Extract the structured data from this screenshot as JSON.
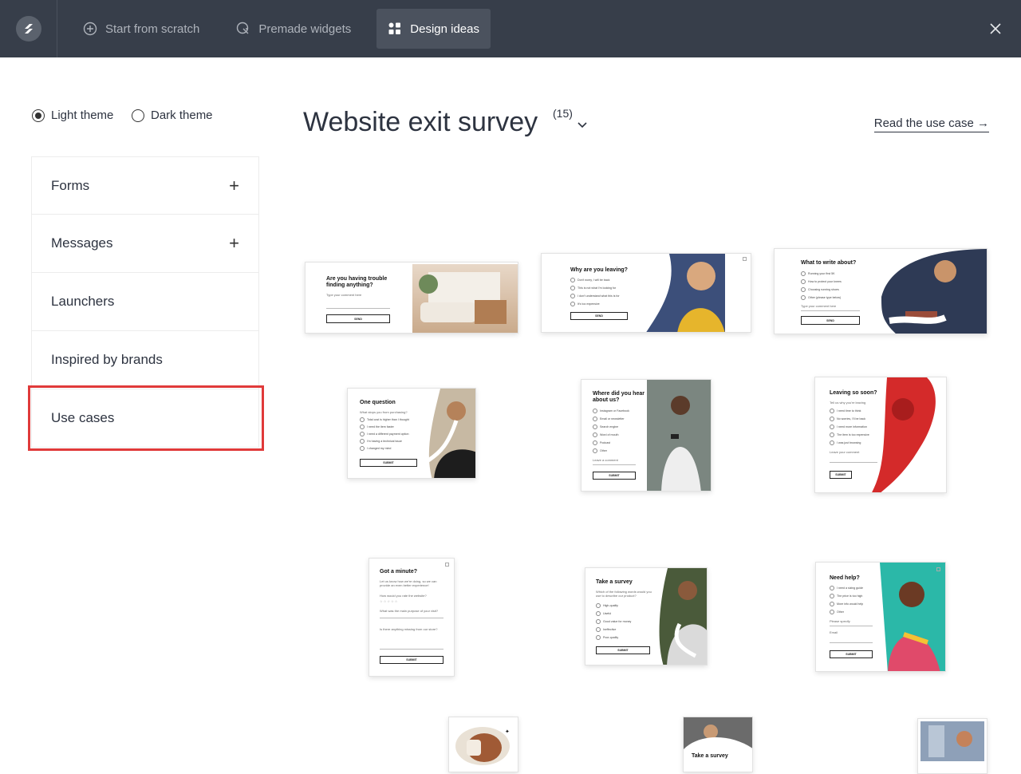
{
  "topbar": {
    "tabs": [
      {
        "label": "Start from scratch",
        "icon": "plus-circle-icon"
      },
      {
        "label": "Premade widgets",
        "icon": "widget-icon"
      },
      {
        "label": "Design ideas",
        "icon": "grid-icon"
      }
    ]
  },
  "theme": {
    "light": "Light theme",
    "dark": "Dark theme"
  },
  "sidebar": {
    "items": [
      {
        "label": "Forms"
      },
      {
        "label": "Messages"
      },
      {
        "label": "Launchers"
      },
      {
        "label": "Inspired by brands"
      },
      {
        "label": "Use cases"
      }
    ]
  },
  "main": {
    "title": "Website exit survey",
    "count": "(15)",
    "read_link": "Read the use case →"
  },
  "cards": [
    {
      "title": "Are you having trouble finding anything?",
      "sub": "Type your comment here",
      "button": "SEND"
    },
    {
      "title": "Why are you leaving?",
      "options": [
        "Don't worry, I will be back",
        "This is not what I'm looking for",
        "I don't understand what this is for",
        "It's too expensive"
      ],
      "button": "SEND"
    },
    {
      "title": "What to write about?",
      "options": [
        "Running your first 5K",
        "How to protect your knees",
        "Choosing running shoes",
        "Other (please type below)"
      ],
      "sub": "Type your comment here",
      "button": "SEND"
    },
    {
      "title": "One question",
      "sub": "What stops you from purchasing?",
      "options": [
        "Total cost is higher than I thought",
        "I need the item faster",
        "I need a different payment option",
        "I'm having a technical issue",
        "I changed my mind"
      ],
      "button": "SUBMIT"
    },
    {
      "title": "Where did you hear about us?",
      "options": [
        "Instagram or Facebook",
        "Email or newsletter",
        "Search engine",
        "Word of mouth",
        "Podcast",
        "Other"
      ],
      "sub": "Leave a comment",
      "button": "SUBMIT"
    },
    {
      "title": "Leaving so soon?",
      "sub": "Tell us why you're leaving",
      "options": [
        "I need time to think",
        "No worries, I'll be back",
        "I need more information",
        "The item is too expensive",
        "I was just browsing"
      ],
      "sub2": "Leave your comment",
      "button": "SUBMIT"
    },
    {
      "title": "Got a minute?",
      "sub": "Let us know how we're doing, so we can provide an even better experience!",
      "q1": "How would you rate the website?",
      "q2": "What was the main purpose of your visit?",
      "q3": "Is there anything missing from our store?",
      "button": "SUBMIT"
    },
    {
      "title": "Take a survey",
      "sub": "Which of the following words would you use to describe our product?",
      "options": [
        "High-quality",
        "Useful",
        "Good value for money",
        "Ineffective",
        "Poor-quality"
      ],
      "button": "SUBMIT"
    },
    {
      "title": "Need help?",
      "options": [
        "I need a sizing guide",
        "The price is too high",
        "More info would help",
        "Other"
      ],
      "sub": "Please specify",
      "sub2": "Email",
      "button": "SUBMIT"
    },
    {
      "title": ""
    },
    {
      "title": "Take a survey"
    },
    {
      "title": ""
    }
  ]
}
